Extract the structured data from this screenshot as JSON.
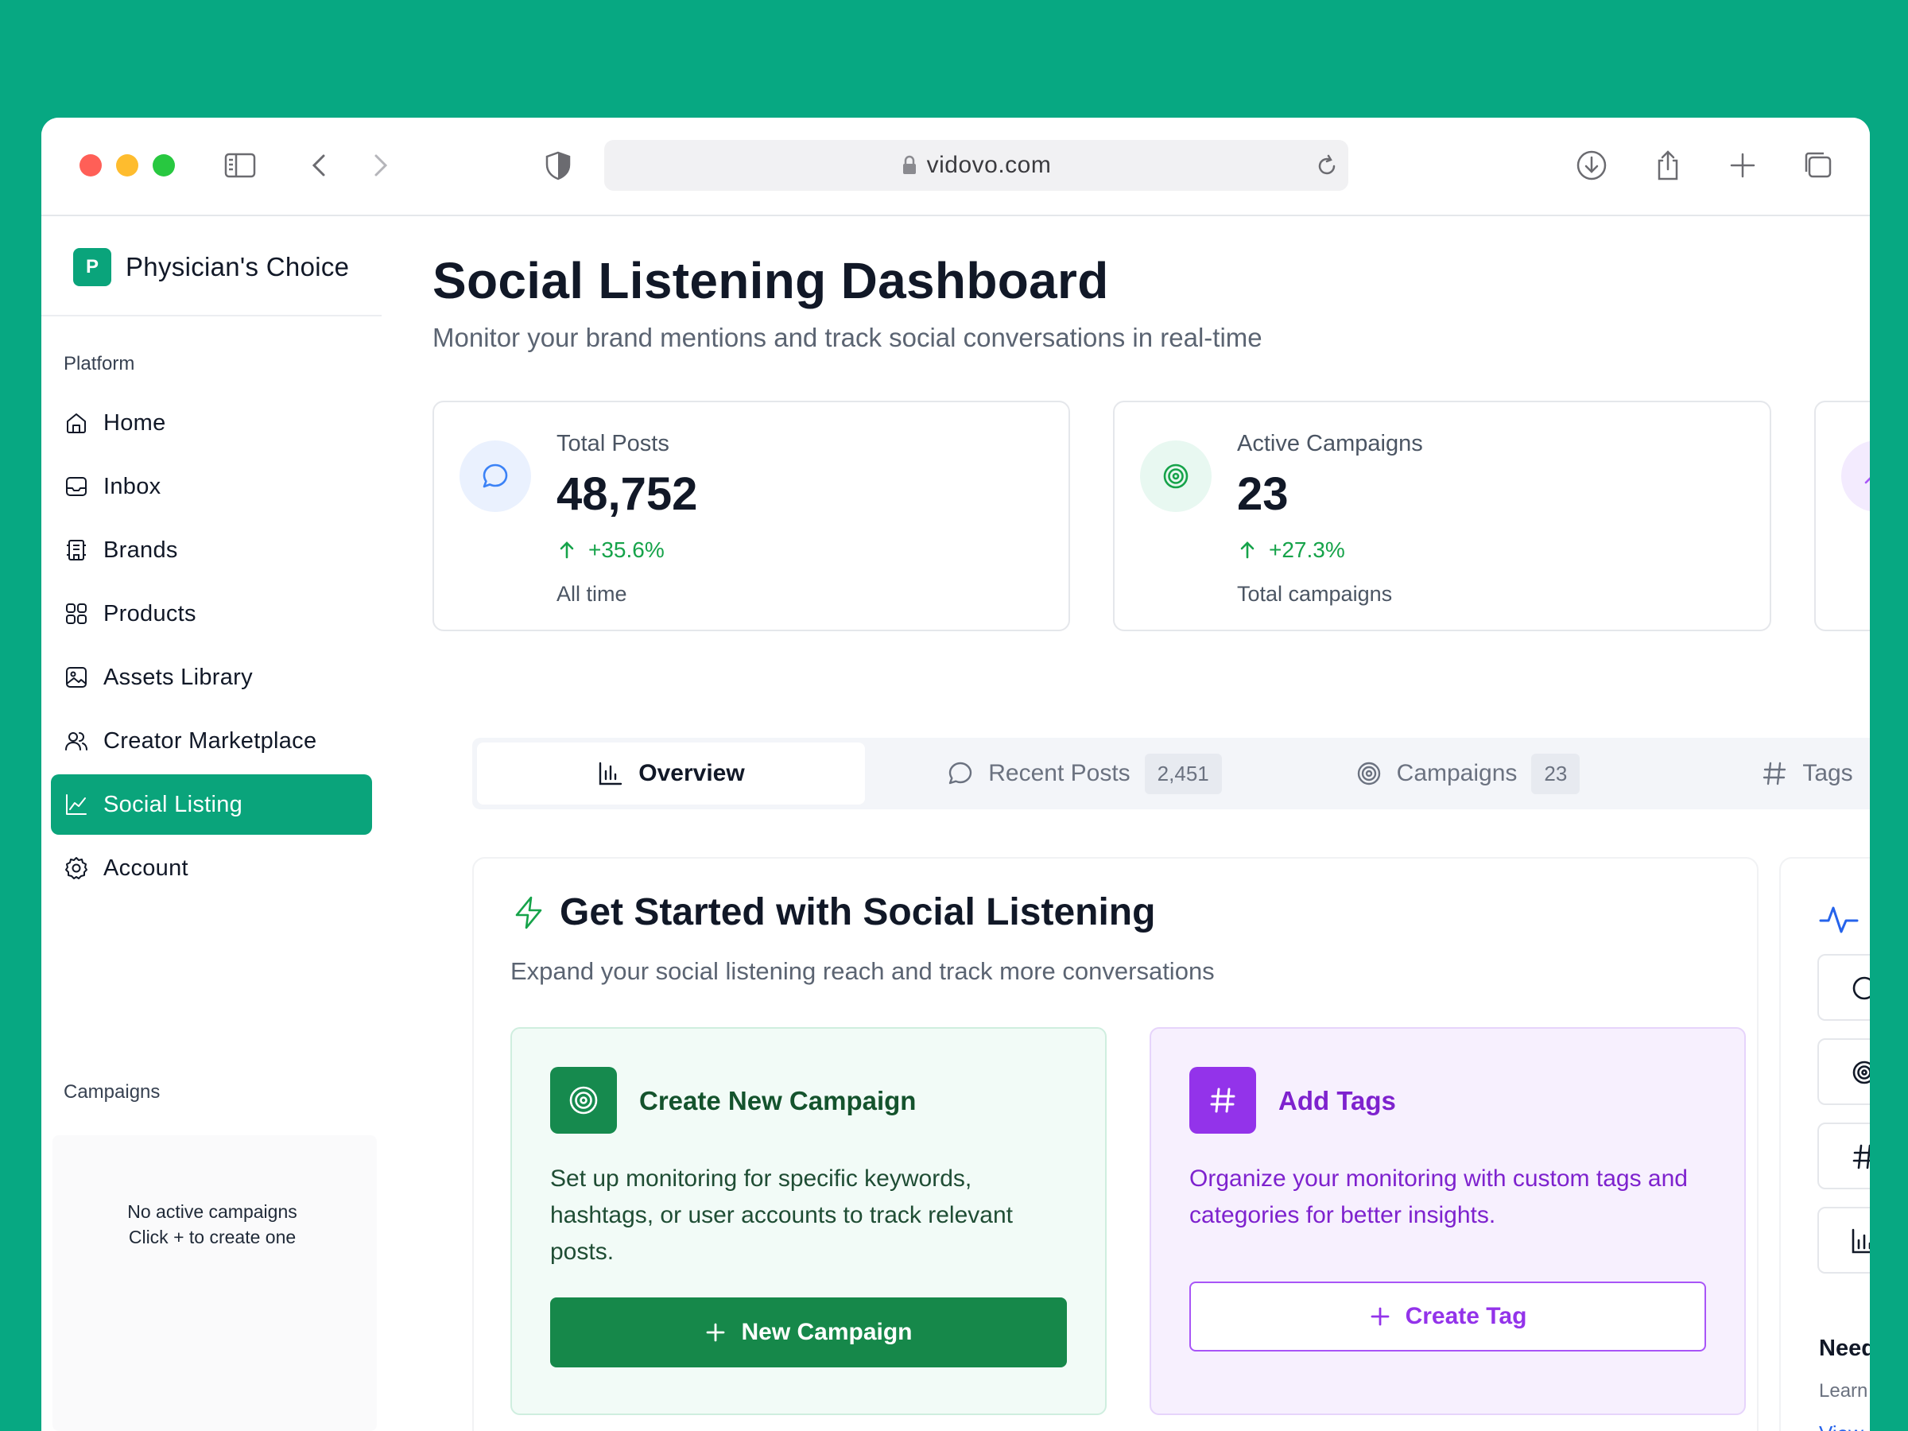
{
  "browser": {
    "url": "vidovo.com"
  },
  "sidebar": {
    "brand_initial": "P",
    "brand_name": "Physician's Choice",
    "platform_label": "Platform",
    "items": [
      {
        "label": "Home",
        "icon": "home-icon"
      },
      {
        "label": "Inbox",
        "icon": "inbox-icon"
      },
      {
        "label": "Brands",
        "icon": "brands-icon"
      },
      {
        "label": "Products",
        "icon": "products-icon"
      },
      {
        "label": "Assets Library",
        "icon": "image-icon"
      },
      {
        "label": "Creator Marketplace",
        "icon": "users-icon"
      },
      {
        "label": "Social Listing",
        "icon": "chart-line-icon",
        "active": true
      },
      {
        "label": "Account",
        "icon": "gear-icon"
      }
    ],
    "campaigns_label": "Campaigns",
    "empty_line1": "No active campaigns",
    "empty_line2": "Click + to create one"
  },
  "header": {
    "title": "Social Listening Dashboard",
    "subtitle": "Monitor your brand mentions and track social conversations in real-time"
  },
  "stats": [
    {
      "label": "Total Posts",
      "value": "48,752",
      "change": "+35.6%",
      "footnote": "All time",
      "icon": "message-circle-icon"
    },
    {
      "label": "Active Campaigns",
      "value": "23",
      "change": "+27.3%",
      "footnote": "Total campaigns",
      "icon": "target-icon"
    }
  ],
  "tabs": [
    {
      "label": "Overview",
      "active": true
    },
    {
      "label": "Recent Posts",
      "count": "2,451"
    },
    {
      "label": "Campaigns",
      "count": "23"
    },
    {
      "label": "Tags"
    }
  ],
  "get_started": {
    "title": "Get Started with Social Listening",
    "subtitle": "Expand your social listening reach and track more conversations",
    "campaign_card": {
      "title": "Create New Campaign",
      "description": "Set up monitoring for specific keywords, hashtags, or user accounts to track relevant posts.",
      "button": "New Campaign"
    },
    "tags_card": {
      "title": "Add Tags",
      "description": "Organize your monitoring with custom tags and categories for better insights.",
      "button": "Create Tag"
    }
  },
  "right_panel": {
    "need_text": "Need",
    "learn_text": "Learn",
    "view_text": "View"
  },
  "colors": {
    "background": "#07a882",
    "accent": "#0aa47b",
    "positive": "#16a34a",
    "campaign_green": "#16884a",
    "tag_purple": "#9333ea"
  }
}
